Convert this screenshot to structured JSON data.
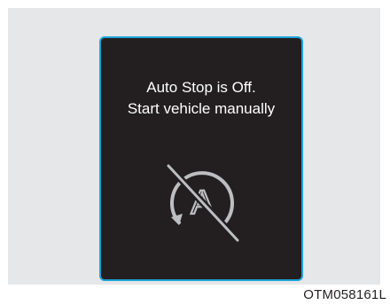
{
  "display": {
    "message_line1": "Auto Stop is Off.",
    "message_line2": "Start vehicle manually",
    "icon": "auto-stop-off-icon",
    "icon_letter": "A"
  },
  "figure_code": "OTM058161L",
  "colors": {
    "screen_background": "#231f20",
    "screen_border": "#1ea3d9",
    "frame_background": "#e6e7e8",
    "text": "#ffffff",
    "icon_stroke": "#bcbec0"
  }
}
